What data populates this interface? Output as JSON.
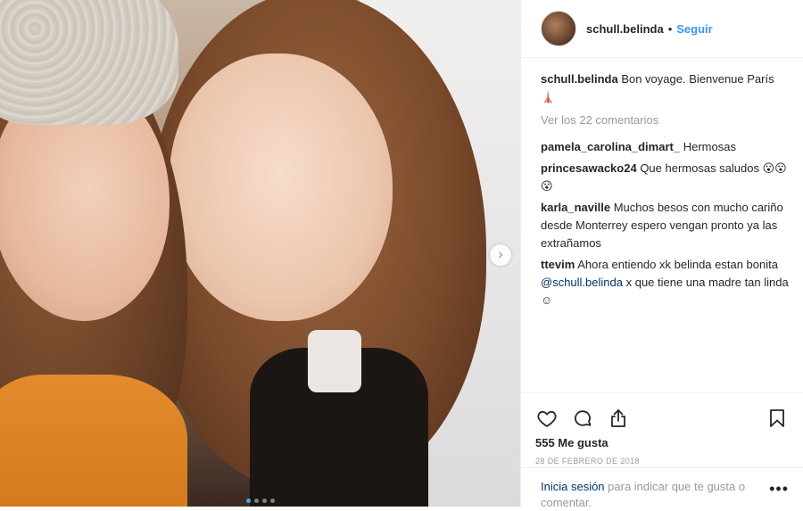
{
  "post": {
    "photo": {
      "next_icon": "chevron-right-icon",
      "carousel": {
        "count": 4,
        "active_index": 0
      }
    },
    "header": {
      "username": "schull.belinda",
      "separator": "•",
      "follow_label": "Seguir"
    },
    "caption": {
      "username": "schull.belinda",
      "text": "Bon voyage. Bienvenue París 🗼"
    },
    "view_all_comments": "Ver los 22 comentarios",
    "comments": [
      {
        "username": "pamela_carolina_dimart_",
        "text": "Hermosas"
      },
      {
        "username": "princesawacko24",
        "text": "Que hermosas saludos 😮😮😮"
      },
      {
        "username": "karla_naville",
        "text": "Muchos besos con mucho cariño desde Monterrey espero vengan pronto ya las extrañamos"
      },
      {
        "username": "ttevim",
        "text_before": "Ahora entiendo xk belinda estan bonita ",
        "mention": "@schull.belinda",
        "text_after": " x que tiene una madre tan linda ☺"
      }
    ],
    "actions": {
      "like_icon": "heart-icon",
      "comment_icon": "comment-icon",
      "share_icon": "share-icon",
      "save_icon": "bookmark-icon"
    },
    "likes": "555 Me gusta",
    "date": "28 de febrero de 2018",
    "login": {
      "link": "Inicia sesión",
      "text": " para indicar que te gusta o comentar.",
      "more_icon": "more-options-icon"
    },
    "colors": {
      "link_blue": "#3897f0",
      "text": "#262626",
      "muted": "#999999",
      "border": "#efefef"
    }
  }
}
